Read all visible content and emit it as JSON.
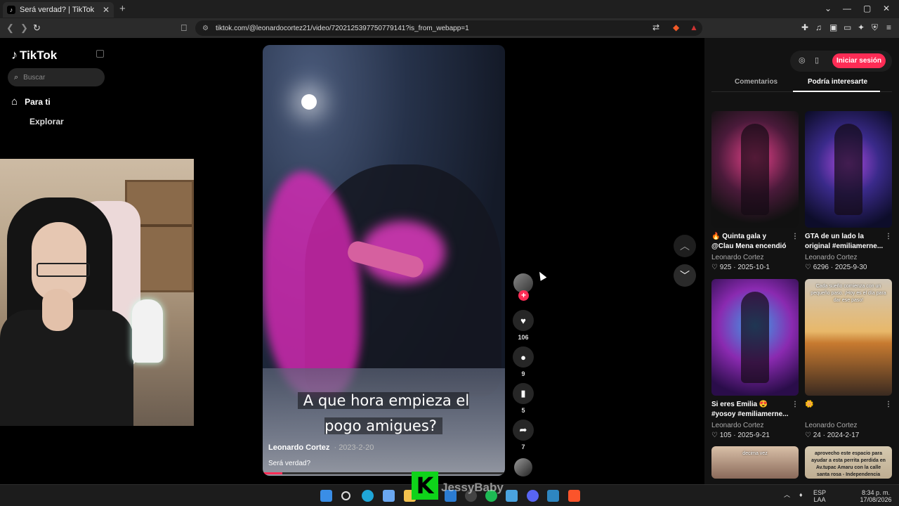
{
  "browser": {
    "tab_title": "Será verdad? | TikTok",
    "tab_favicon": "tiktok-icon",
    "url": "tiktok.com/@leonardocortez21/video/7202125397750779141?is_from_webapp=1"
  },
  "sidebar": {
    "logo": "TikTok",
    "search_placeholder": "Buscar",
    "nav_items": [
      {
        "label": "Para ti",
        "icon": "home-icon"
      },
      {
        "label": "Explorar",
        "icon": "compass-icon"
      }
    ]
  },
  "video": {
    "caption": "A que hora empieza el pogo amigues?",
    "author": "Leonardo Cortez",
    "date": "2023-2-20",
    "description": "Será verdad?",
    "progress_fraction": 0.08
  },
  "actions": {
    "likes": "106",
    "comments": "9",
    "saves": "5",
    "shares": "7",
    "follow_label": "+"
  },
  "right_panel": {
    "login_label": "Iniciar sesión",
    "tabs": [
      {
        "label": "Comentarios",
        "active": false
      },
      {
        "label": "Podría interesarte",
        "active": true
      }
    ],
    "cards": [
      {
        "title": "🔥 Quinta gala y @Clau Mena encendió el...",
        "author": "Leonardo Cortez",
        "likes": "925",
        "date": "2025-10-1",
        "overlay": ""
      },
      {
        "title": "GTA de un lado la original #emiliamerne...",
        "author": "Leonardo Cortez",
        "likes": "6296",
        "date": "2025-9-30",
        "overlay": ""
      },
      {
        "title": "Si eres Emilia 😍 #yosoy #emiliamerne...",
        "author": "Leonardo Cortez",
        "likes": "105",
        "date": "2025-9-21",
        "overlay": ""
      },
      {
        "title": "🌼",
        "author": "Leonardo Cortez",
        "likes": "24",
        "date": "2024-2-17",
        "overlay": "Cada sueño comienza con un pequeño paso. ¡Hoy es el día para dar ese paso!"
      },
      {
        "title": "",
        "author": "",
        "likes": "",
        "date": "",
        "overlay": "decima vez"
      },
      {
        "title": "",
        "author": "",
        "likes": "",
        "date": "",
        "overlay": "aprovecho este espacio para ayudar a esta perrita perdida en Av.tupac Amaru con la calle santa rosa - Independencia"
      }
    ]
  },
  "streamer": {
    "logo_letter": "K",
    "name": "JessyBaby"
  },
  "taskbar": {
    "lang_top": "ESP",
    "lang_bottom": "LAA",
    "time": "8:34 p. m.",
    "date": "17/08/2026"
  },
  "colors": {
    "accent": "#fe2c55",
    "background": "#000000",
    "panel": "#121212"
  }
}
